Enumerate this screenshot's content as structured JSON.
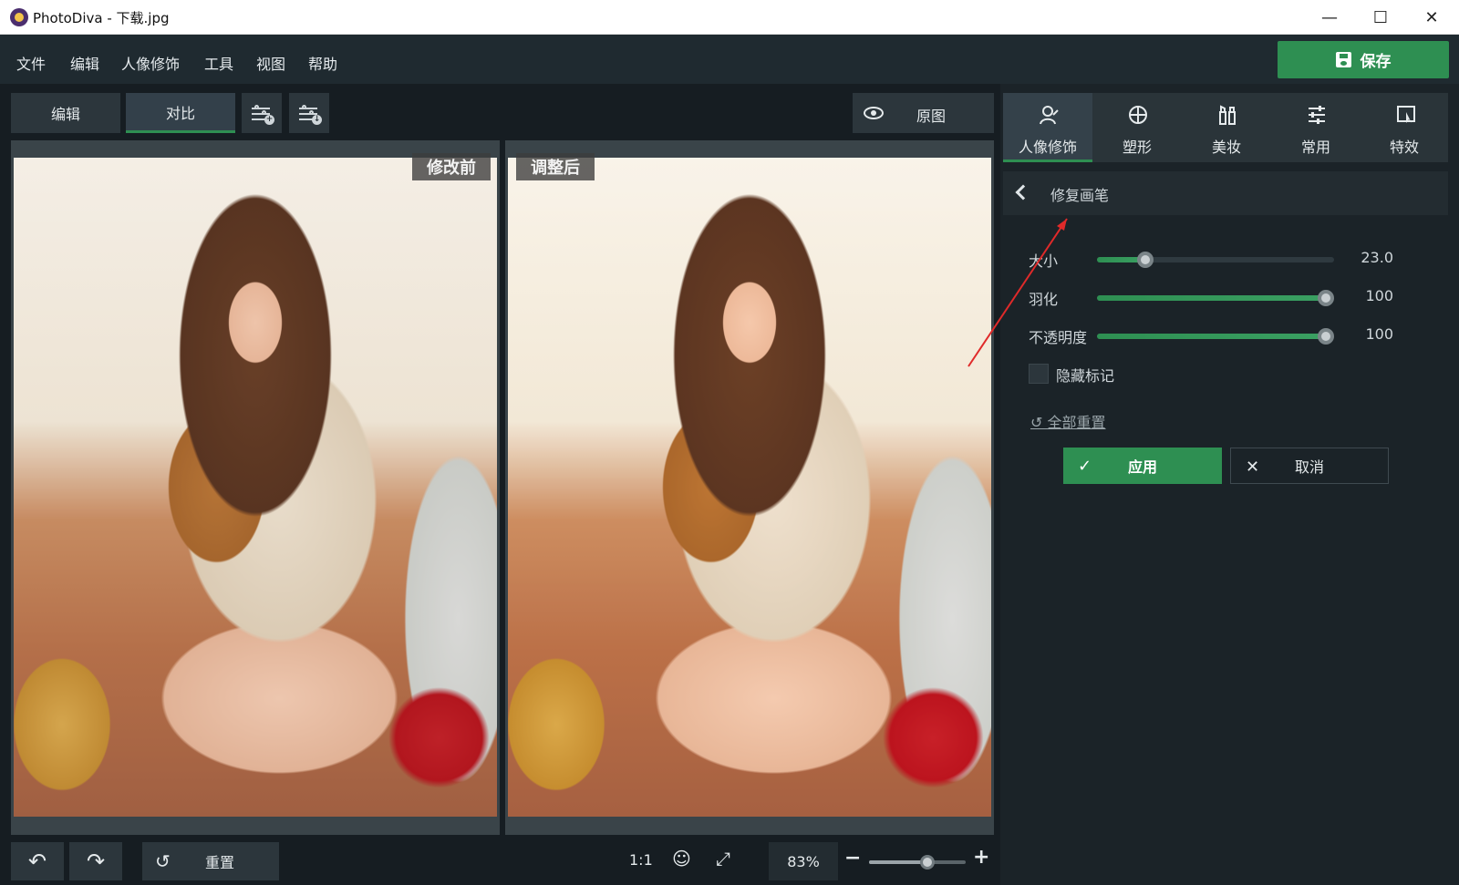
{
  "window": {
    "title": "PhotoDiva - 下载.jpg",
    "minimize": "—",
    "maximize": "☐",
    "close": "✕"
  },
  "menu": [
    "文件",
    "编辑",
    "人像修饰",
    "工具",
    "视图",
    "帮助"
  ],
  "save_label": "保存",
  "toolbar": {
    "edit": "编辑",
    "compare": "对比",
    "original": "原图"
  },
  "panes": {
    "before": "修改前",
    "after": "调整后"
  },
  "bottom": {
    "reset": "重置",
    "ratio": "1:1",
    "zoom": "83%",
    "zoom_level": 0.62
  },
  "right_tabs": [
    {
      "label": "人像修饰",
      "icon": "portrait-icon",
      "active": true
    },
    {
      "label": "塑形",
      "icon": "reshape-icon",
      "active": false
    },
    {
      "label": "美妆",
      "icon": "makeup-icon",
      "active": false
    },
    {
      "label": "常用",
      "icon": "sliders-icon",
      "active": false
    },
    {
      "label": "特效",
      "icon": "effects-icon",
      "active": false
    }
  ],
  "section_title": "修复画笔",
  "params": [
    {
      "label": "大小",
      "value": "23.0",
      "level": 0.18
    },
    {
      "label": "羽化",
      "value": "100",
      "level": 1.0
    },
    {
      "label": "不透明度",
      "value": "100",
      "level": 1.0
    }
  ],
  "hide_marks": {
    "label": "隐藏标记",
    "checked": false
  },
  "reset_all": "全部重置",
  "apply": "应用",
  "cancel": "取消",
  "colors": {
    "accent": "#2e8f52",
    "bg": "#1b2328",
    "annotation": "#e02a2a"
  }
}
